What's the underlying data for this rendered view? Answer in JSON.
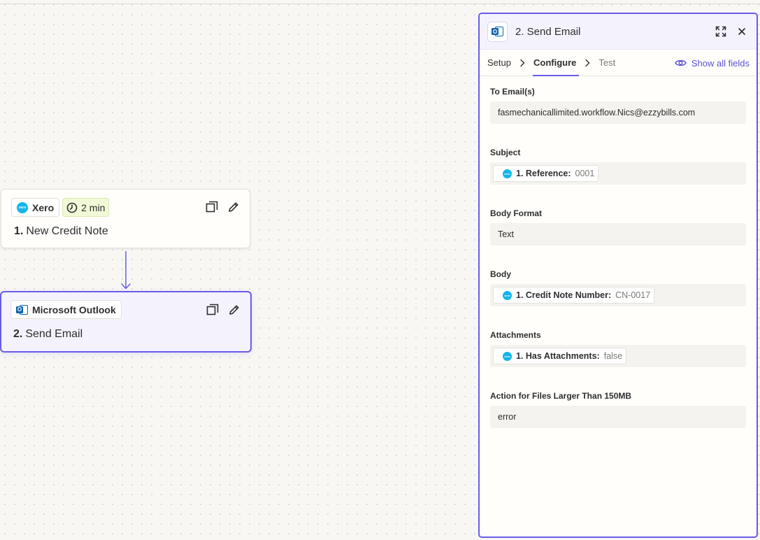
{
  "steps": [
    {
      "app": "Xero",
      "delay": "2 min",
      "number": "1.",
      "title": "New Credit Note"
    },
    {
      "app": "Microsoft Outlook",
      "number": "2.",
      "title": "Send Email"
    }
  ],
  "panel": {
    "title": "2. Send Email",
    "tabs": [
      "Setup",
      "Configure",
      "Test"
    ],
    "active_tab": "Configure",
    "show_all_fields": "Show all fields",
    "fields": {
      "to": {
        "label": "To Email(s)",
        "value": "fasmechanicallimited.workflow.Nics@ezzybills.com"
      },
      "subject": {
        "label": "Subject",
        "token_label": "1. Reference:",
        "token_value": "0001"
      },
      "body_format": {
        "label": "Body Format",
        "value": "Text"
      },
      "body": {
        "label": "Body",
        "token_label": "1. Credit Note Number:",
        "token_value": "CN-0017"
      },
      "attachments": {
        "label": "Attachments",
        "token_label": "1. Has Attachments:",
        "token_value": "false"
      },
      "large_files": {
        "label": "Action for Files Larger Than 150MB",
        "value": "error"
      }
    }
  },
  "logos": {
    "xero_text": "xero",
    "outlook_letter": "O"
  },
  "colors": {
    "accent": "#695be8",
    "xero": "#13b5ea",
    "outlook": "#0a64ad",
    "delay_bg": "#f2f9d6"
  }
}
